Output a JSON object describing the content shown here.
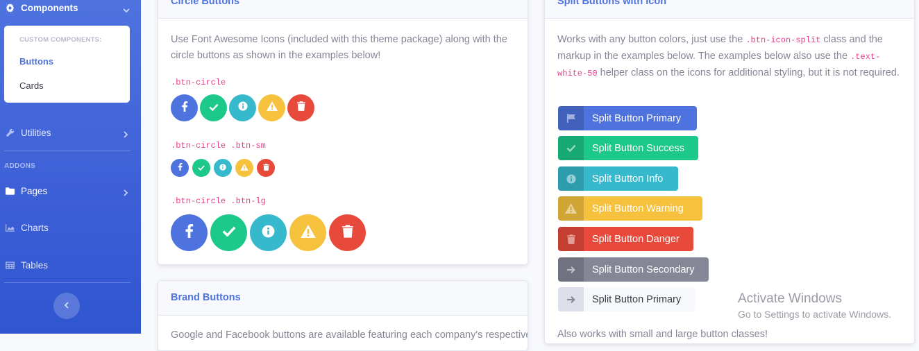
{
  "sidebar": {
    "components_label": "Components",
    "submenu": {
      "heading": "CUSTOM COMPONENTS:",
      "items": [
        {
          "label": "Buttons"
        },
        {
          "label": "Cards"
        }
      ]
    },
    "utilities_label": "Utilities",
    "addons_heading": "ADDONS",
    "pages_label": "Pages",
    "charts_label": "Charts",
    "tables_label": "Tables"
  },
  "circle_card": {
    "title": "Circle Buttons",
    "description": "Use Font Awesome Icons (included with this theme package) along with the circle buttons as shown in the examples below!",
    "label_default": ".btn-circle",
    "label_sm": ".btn-circle .btn-sm",
    "label_lg": ".btn-circle .btn-lg"
  },
  "brand_card": {
    "title": "Brand Buttons",
    "description": "Google and Facebook buttons are available featuring each company's respective brand color. They are used on the user login and registration pages."
  },
  "split_card": {
    "title": "Split Buttons with Icon",
    "desc_1": "Works with any button colors, just use the ",
    "code_1": ".btn-icon-split",
    "desc_2": " class and the markup in the examples below. The examples below also use the ",
    "code_2a": ".text-",
    "code_2b": "white-50",
    "desc_3": " helper class on the icons for additional styling, but it is not required.",
    "buttons": [
      {
        "label": "Split Button Primary",
        "icon": "flag-icon",
        "color": "#4e73df"
      },
      {
        "label": "Split Button Success",
        "icon": "check-icon",
        "color": "#1cc88a"
      },
      {
        "label": "Split Button Info",
        "icon": "info-circle-icon",
        "color": "#36b9cc"
      },
      {
        "label": "Split Button Warning",
        "icon": "exclamation-triangle-icon",
        "color": "#f6c23e"
      },
      {
        "label": "Split Button Danger",
        "icon": "trash-icon",
        "color": "#e74a3b"
      },
      {
        "label": "Split Button Secondary",
        "icon": "arrow-right-icon",
        "color": "#858796"
      },
      {
        "label": "Split Button Primary",
        "icon": "arrow-right-icon",
        "color": "#f8f9fc"
      }
    ],
    "footer_text": "Also works with small and large button classes!"
  },
  "watermark": {
    "title": "Activate Windows",
    "subtitle": "Go to Settings to activate Windows."
  }
}
